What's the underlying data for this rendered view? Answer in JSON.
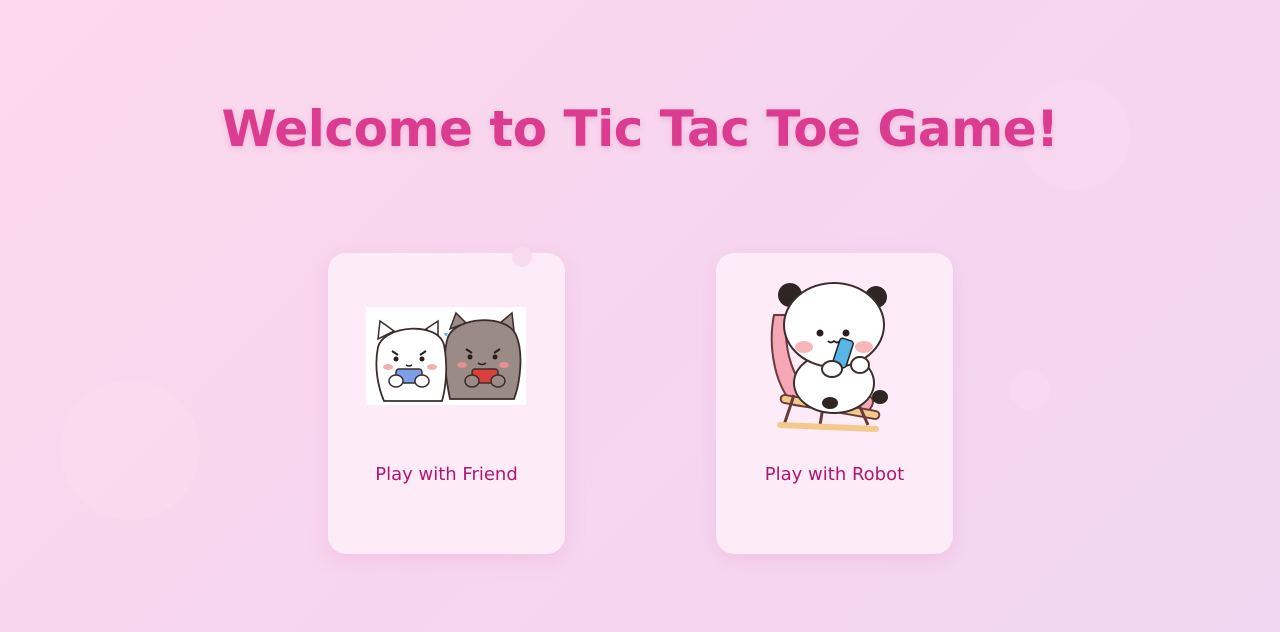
{
  "title": "Welcome to Tic Tac Toe Game!",
  "modes": [
    {
      "label": "Play with Friend",
      "illustration": "cats-playing-games-illustration"
    },
    {
      "label": "Play with Robot",
      "illustration": "panda-playing-phone-illustration"
    }
  ],
  "colors": {
    "title": "#dc3c8f",
    "card_label": "#b0166e",
    "card_background": "#fdecf7",
    "page_background": "#f7d6ef"
  }
}
